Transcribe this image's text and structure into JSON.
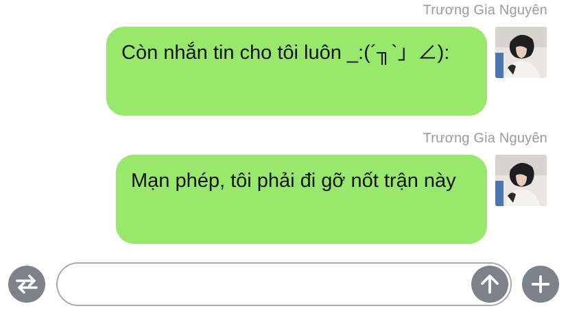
{
  "messages": [
    {
      "sender": "Trương Gia Nguyên",
      "text": "Còn nhắn tin cho tôi luôn _:(´╖`」∠):"
    },
    {
      "sender": "Trương Gia Nguyên",
      "text": "Mạn phép, tôi phải đi gỡ nốt trận này"
    }
  ],
  "composer": {
    "placeholder": "",
    "value": "",
    "left_icon": "swap-arrows-icon",
    "send_icon": "arrow-up-icon",
    "right_icon": "plus-icon"
  },
  "colors": {
    "bubble": "#98e86d",
    "sender_name": "#9b9b9b",
    "icon_button": "#7d828a",
    "input_border": "#a9a9a9"
  }
}
